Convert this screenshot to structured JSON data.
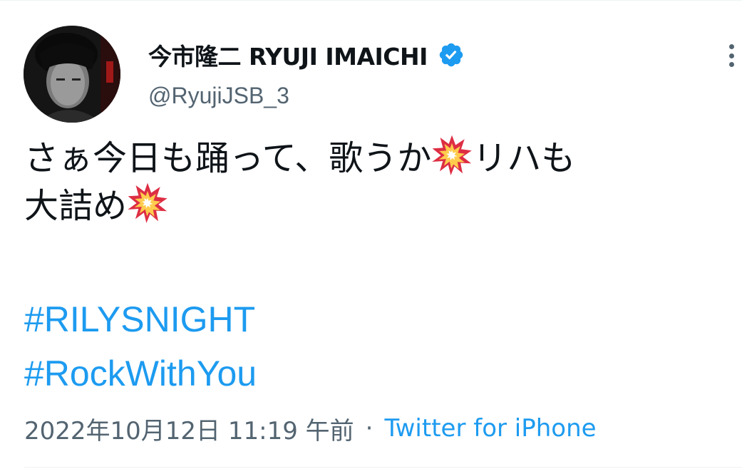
{
  "tweet": {
    "display_name": "今市隆二 RYUJI IMAICHI",
    "handle": "@RyujiJSB_3",
    "verified_icon": "verified-badge-icon",
    "more_icon": "more-vertical-icon",
    "avatar_icon": "profile-photo",
    "body": {
      "line1_text": "さぁ今日も踊って、歌うか",
      "line1_emoji": "collision-emoji",
      "line1_tail": "リハも",
      "line2_text": "大詰め",
      "line2_emoji": "collision-emoji"
    },
    "hashtags": [
      "#RILYSNIGHT",
      "#RockWithYou"
    ],
    "timestamp": "2022年10月12日 11:19 午前",
    "separator": "·",
    "source": "Twitter for iPhone"
  },
  "colors": {
    "text": "#0f1419",
    "secondary": "#536471",
    "accent": "#1d9bf0",
    "divider": "#eff3f4"
  }
}
